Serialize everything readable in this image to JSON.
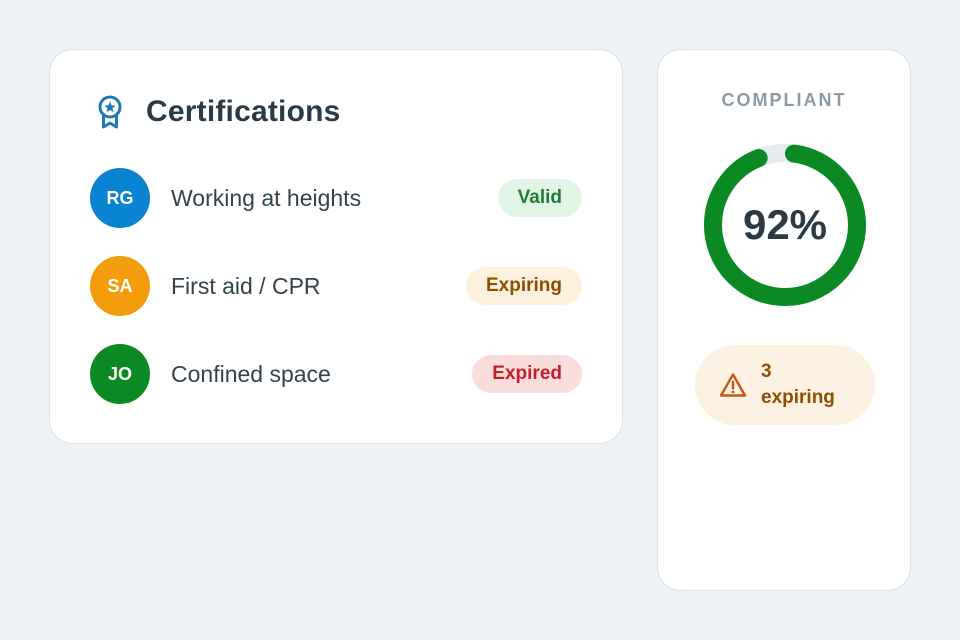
{
  "certifications": {
    "title": "Certifications",
    "icon": "award-ribbon-icon",
    "items": [
      {
        "initials": "RG",
        "avatar_color": "#0a84d0",
        "name": "Working at heights",
        "status": "Valid"
      },
      {
        "initials": "SA",
        "avatar_color": "#f39c0c",
        "name": "First aid / CPR",
        "status": "Expiring"
      },
      {
        "initials": "JO",
        "avatar_color": "#0b8a23",
        "name": "Confined space",
        "status": "Expired"
      }
    ]
  },
  "compliance": {
    "label": "COMPLIANT",
    "percent_text": "92%",
    "percent_value": 92,
    "ring_color": "#0b8a23",
    "ring_track_color": "#e6ebef",
    "alert": {
      "icon": "warning-triangle-icon",
      "count": "3",
      "text": "expiring"
    }
  },
  "colors": {
    "background": "#eef2f5",
    "valid_bg": "#e0f5e5",
    "valid_fg": "#1e7f3a",
    "expiring_bg": "#fdf0dc",
    "expiring_fg": "#8a4f00",
    "expired_bg": "#fbdcdc",
    "expired_fg": "#c01f2a"
  }
}
